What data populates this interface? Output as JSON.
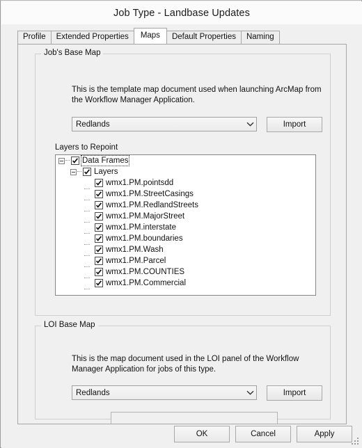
{
  "window": {
    "title": "Job Type - Landbase Updates"
  },
  "tabs": [
    {
      "label": "Profile",
      "selected": false
    },
    {
      "label": "Extended Properties",
      "selected": false
    },
    {
      "label": "Maps",
      "selected": true
    },
    {
      "label": "Default Properties",
      "selected": false
    },
    {
      "label": "Naming",
      "selected": false
    }
  ],
  "jobs_base_map": {
    "legend": "Job's Base Map",
    "description": "This is the template map document used when launching ArcMap from\nthe Workflow Manager Application.",
    "combo_value": "Redlands",
    "import_label": "Import",
    "dropdown_icon": "chevron-down-icon"
  },
  "layers_to_repoint": {
    "label": "Layers to Repoint",
    "nodes": [
      {
        "label": "Data Frames",
        "level": 1,
        "checked": true,
        "expanded": true,
        "focused": true
      },
      {
        "label": "Layers",
        "level": 2,
        "checked": true,
        "expanded": true,
        "focused": false
      },
      {
        "label": "wmx1.PM.pointsdd",
        "level": 3,
        "checked": true,
        "expanded": null,
        "focused": false
      },
      {
        "label": "wmx1.PM.StreetCasings",
        "level": 3,
        "checked": true,
        "expanded": null,
        "focused": false
      },
      {
        "label": "wmx1.PM.RedlandStreets",
        "level": 3,
        "checked": true,
        "expanded": null,
        "focused": false
      },
      {
        "label": "wmx1.PM.MajorStreet",
        "level": 3,
        "checked": true,
        "expanded": null,
        "focused": false
      },
      {
        "label": "wmx1.PM.interstate",
        "level": 3,
        "checked": true,
        "expanded": null,
        "focused": false
      },
      {
        "label": "wmx1.PM.boundaries",
        "level": 3,
        "checked": true,
        "expanded": null,
        "focused": false
      },
      {
        "label": "wmx1.PM.Wash",
        "level": 3,
        "checked": true,
        "expanded": null,
        "focused": false
      },
      {
        "label": "wmx1.PM.Parcel",
        "level": 3,
        "checked": true,
        "expanded": null,
        "focused": false
      },
      {
        "label": "wmx1.PM.COUNTIES",
        "level": 3,
        "checked": true,
        "expanded": null,
        "focused": false
      },
      {
        "label": "wmx1.PM.Commercial",
        "level": 3,
        "checked": true,
        "expanded": null,
        "focused": false
      }
    ]
  },
  "loi_base_map": {
    "legend": "LOI Base Map",
    "description": "This is the map document used in the LOI panel of the Workflow\nManager Application for jobs of this type.",
    "combo_value": "Redlands",
    "import_label": "Import",
    "dropdown_icon": "chevron-down-icon"
  },
  "footer": {
    "ok_label": "OK",
    "cancel_label": "Cancel",
    "apply_label": "Apply",
    "resize_grip_icon": "resize-grip-icon"
  },
  "colors": {
    "dialog_background": "#f0f0f0",
    "titlebar_background": "#fbfbfb",
    "tab_selected_background": "#ffffff",
    "treeview_background": "#ffffff",
    "border": "#a6a6a6",
    "text": "#111111"
  }
}
